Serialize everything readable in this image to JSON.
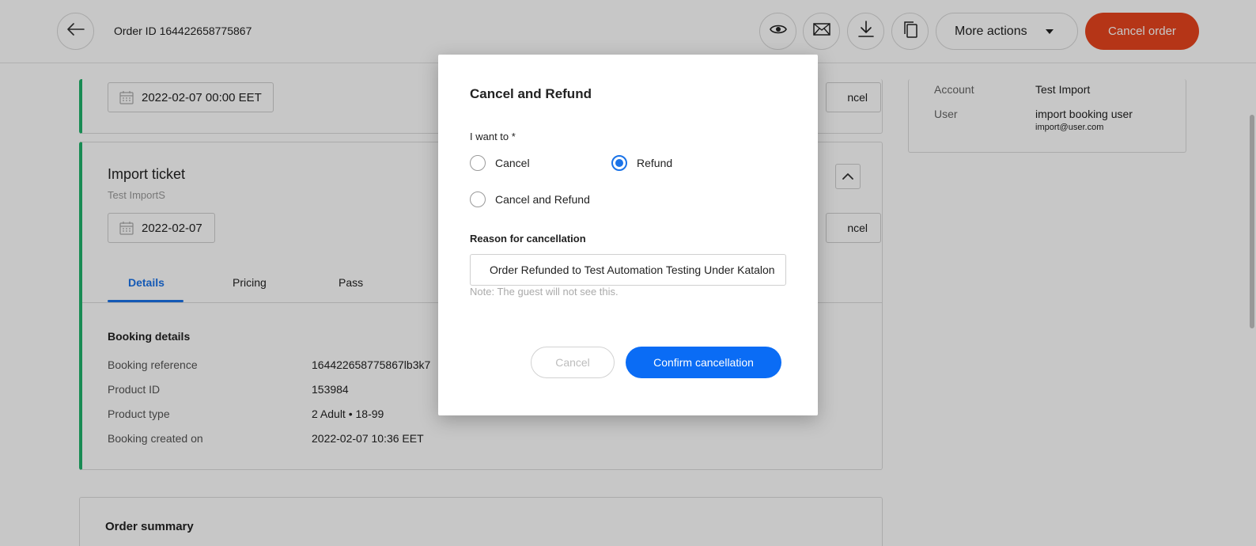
{
  "header": {
    "order_id": "Order ID 164422658775867",
    "more_actions_label": "More actions",
    "cancel_order_label": "Cancel order"
  },
  "top_card": {
    "date": "2022-02-07 00:00 EET",
    "cancel_label": "ncel"
  },
  "ticket_card": {
    "title": "Import ticket",
    "subtitle": "Test ImportS",
    "date": "2022-02-07",
    "cancel_label": "ncel",
    "tabs": [
      {
        "label": "Details"
      },
      {
        "label": "Pricing"
      },
      {
        "label": "Pass"
      }
    ],
    "booking_details_title": "Booking details",
    "rows": [
      {
        "label": "Booking reference",
        "value": "164422658775867lb3k7"
      },
      {
        "label": "Product ID",
        "value": "153984"
      },
      {
        "label": "Product type",
        "value": "2 Adult • 18-99"
      },
      {
        "label": "Booking created on",
        "value": "2022-02-07 10:36 EET"
      }
    ]
  },
  "right_panel": {
    "account_label": "Account",
    "account_value": "Test Import",
    "user_label": "User",
    "user_value": "import booking user",
    "user_email": "import@user.com"
  },
  "order_summary": {
    "title": "Order summary"
  },
  "modal": {
    "title": "Cancel and Refund",
    "i_want_to_label": "I want to *",
    "options": {
      "cancel": "Cancel",
      "refund": "Refund",
      "cancel_and_refund": "Cancel and Refund"
    },
    "selected_option": "Refund",
    "reason_label": "Reason for cancellation",
    "reason_value": "Order Refunded to Test Automation Testing Under Katalon",
    "note": "Note: The guest will not see this.",
    "cancel_button": "Cancel",
    "confirm_button": "Confirm cancellation"
  },
  "colors": {
    "accent_blue": "#0a6cf5",
    "cancel_order_red": "#e8451e",
    "card_green": "#1fb36b"
  }
}
